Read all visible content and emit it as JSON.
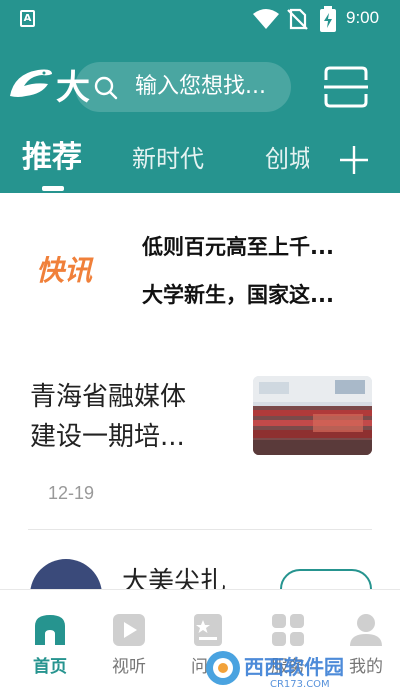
{
  "status_bar": {
    "time": "9:00",
    "app_icon_letter": "A"
  },
  "header": {
    "logo_char": "大",
    "search": {
      "placeholder": "输入您想找..."
    },
    "tabs": [
      {
        "label": "推荐",
        "active": true
      },
      {
        "label": "新时代",
        "active": false
      },
      {
        "label": "创城",
        "active": false
      }
    ]
  },
  "feed": {
    "flash": {
      "logo": "快讯",
      "lines": [
        "低则百元高至上千...",
        "大学新生，国家这..."
      ]
    },
    "news1": {
      "title_lines": [
        "青海省融媒体",
        "建设一期培..."
      ],
      "date": "12-19"
    },
    "news2": {
      "title": "大美尖扎"
    }
  },
  "bottom_nav": [
    {
      "label": "首页",
      "icon": "home-icon",
      "active": true
    },
    {
      "label": "视听",
      "icon": "play-icon",
      "active": false
    },
    {
      "label": "问政",
      "icon": "inquiry-icon",
      "active": false
    },
    {
      "label": "服务",
      "icon": "service-grid-icon",
      "active": false
    },
    {
      "label": "我的",
      "icon": "profile-icon",
      "active": false
    }
  ],
  "watermark": {
    "text": "西西软件园",
    "sub": "CR173.COM"
  },
  "colors": {
    "brand_teal": "#26948f",
    "flash_orange": "#f0803a",
    "date_gray": "#999999"
  }
}
